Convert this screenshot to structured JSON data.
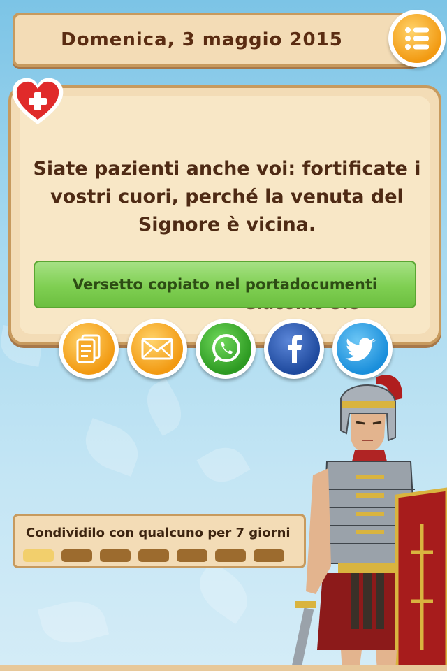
{
  "header": {
    "title": "Domenica, 3  maggio  2015",
    "menu_icon": "list-icon"
  },
  "card": {
    "verse": "Siate pazienti anche voi: fortificate i vostri cuori, perché la venuta del Signore è vicina.",
    "reference": "Giacomo 5:8",
    "favorite_icon": "heart-plus-icon"
  },
  "toast": {
    "message": "Versetto copiato nel portadocumenti"
  },
  "share": {
    "buttons": [
      {
        "name": "copy",
        "icon": "document-icon",
        "color": "#f5a623"
      },
      {
        "name": "email",
        "icon": "envelope-icon",
        "color": "#f5a623"
      },
      {
        "name": "whatsapp",
        "icon": "whatsapp-icon",
        "color": "#3aa629"
      },
      {
        "name": "facebook",
        "icon": "facebook-icon",
        "color": "#2b58b0"
      },
      {
        "name": "twitter",
        "icon": "twitter-icon",
        "color": "#2a9ee8"
      }
    ]
  },
  "progress": {
    "label": "Condividilo con qualcuno per 7 giorni",
    "total_days": 7,
    "completed_days": 1
  },
  "colors": {
    "accent": "#f29a12",
    "panel": "#f3dcb6",
    "toast": "#7fcf52",
    "text": "#4e2a14"
  }
}
